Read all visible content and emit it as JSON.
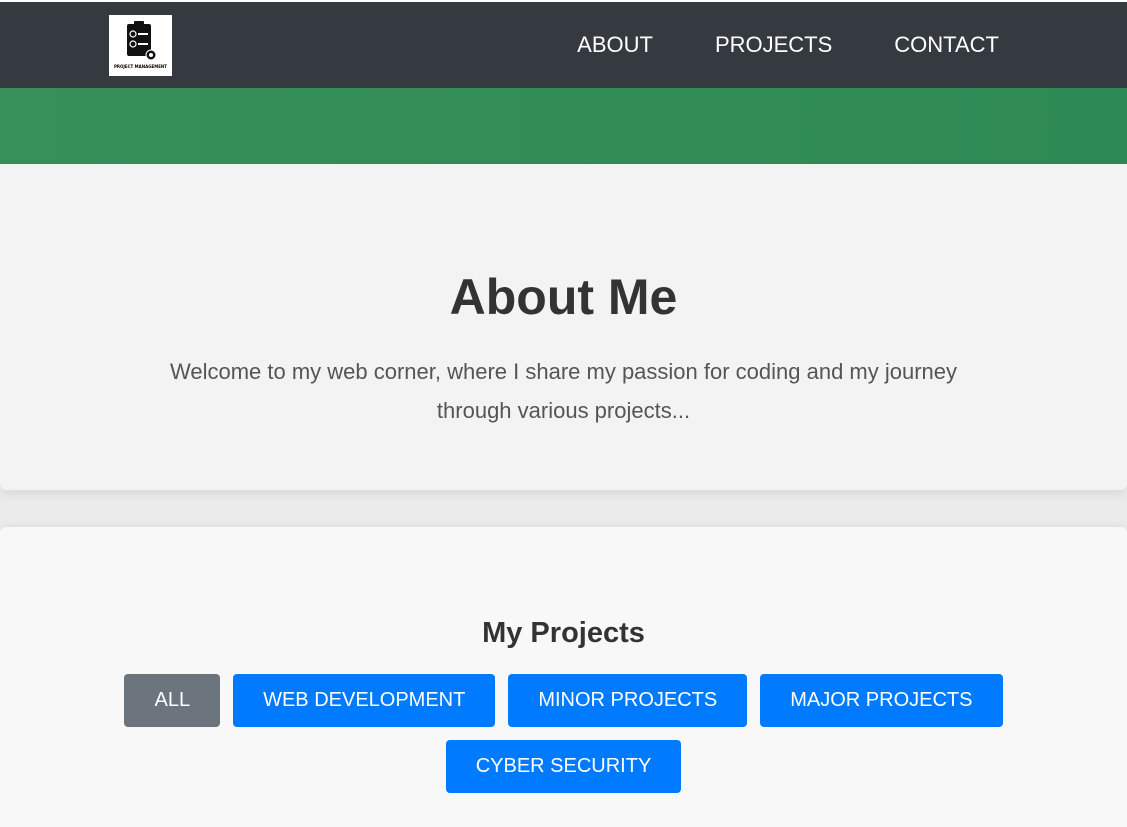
{
  "brand": {
    "logo_text": "PROJECT MANAGEMENT",
    "logo_icon": "clipboard-gear-icon"
  },
  "nav": {
    "items": [
      "ABOUT",
      "PROJECTS",
      "CONTACT"
    ]
  },
  "about": {
    "title": "About Me",
    "text": "Welcome to my web corner, where I share my passion for coding and my journey through various projects..."
  },
  "projects": {
    "title": "My Projects",
    "filters": [
      "ALL",
      "WEB DEVELOPMENT",
      "MINOR PROJECTS",
      "MAJOR PROJECTS",
      "CYBER SECURITY"
    ],
    "active_filter": "ALL"
  },
  "colors": {
    "navbar": "#343a40",
    "hero_green": "#2e8a54",
    "button_primary": "#007bff",
    "button_active": "#6c757d"
  }
}
